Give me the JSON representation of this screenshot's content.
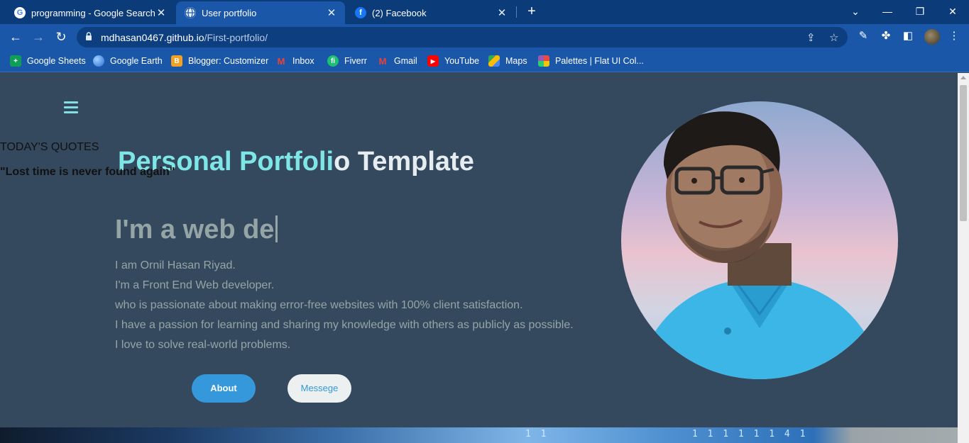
{
  "browser": {
    "tabs": [
      {
        "title": "programming - Google Search",
        "favicon": "google-icon",
        "active": false
      },
      {
        "title": "User portfolio",
        "favicon": "globe-icon",
        "active": true
      },
      {
        "title": "(2) Facebook",
        "favicon": "facebook-icon",
        "active": false
      }
    ],
    "close_glyph": "✕",
    "newtab_glyph": "+",
    "url_host": "mdhasan0467.github.io",
    "url_path": "/First-portfolio/",
    "bookmarks": [
      {
        "label": "Google Sheets",
        "icon": "sheets-icon",
        "color": "#0f9d58"
      },
      {
        "label": "Google Earth",
        "icon": "earth-icon",
        "color": "#4285f4"
      },
      {
        "label": "Blogger: Customizer",
        "icon": "blogger-icon",
        "color": "#f4a020"
      },
      {
        "label": "Inbox",
        "icon": "gmail-icon",
        "color": "#ea4335"
      },
      {
        "label": "Fiverr",
        "icon": "fiverr-icon",
        "color": "#1dbf73"
      },
      {
        "label": "Gmail",
        "icon": "gmail-icon",
        "color": "#ea4335"
      },
      {
        "label": "YouTube",
        "icon": "youtube-icon",
        "color": "#ff0000"
      },
      {
        "label": "Maps",
        "icon": "maps-icon",
        "color": "#34a853"
      },
      {
        "label": "Palettes | Flat UI Col...",
        "icon": "palette-icon",
        "color": "#e74c3c"
      }
    ]
  },
  "page": {
    "quotes_title": "TODAY'S QUOTES",
    "quote": "\"Lost time is never found again\"",
    "title_highlight": "Personal Portfoli",
    "title_rest": "o Template",
    "typed_text": "I'm a web de",
    "bio_lines": [
      "I am Ornil Hasan Riyad.",
      "I'm a Front End Web developer.",
      "who is passionate about making error-free websites with 100% client satisfaction.",
      "I have a passion for learning and sharing my knowledge with others as publicly as possible.",
      "I love to solve real-world problems."
    ],
    "about_button": "About",
    "message_button": "Messege",
    "strip_digits_1": "1  1",
    "strip_digits_2": "1 1 1 1 1 1 4 1"
  },
  "colors": {
    "page_bg": "#34495e",
    "accent": "#7fe6e8",
    "button_blue": "#3498db",
    "muted_text": "#95a5a6"
  }
}
